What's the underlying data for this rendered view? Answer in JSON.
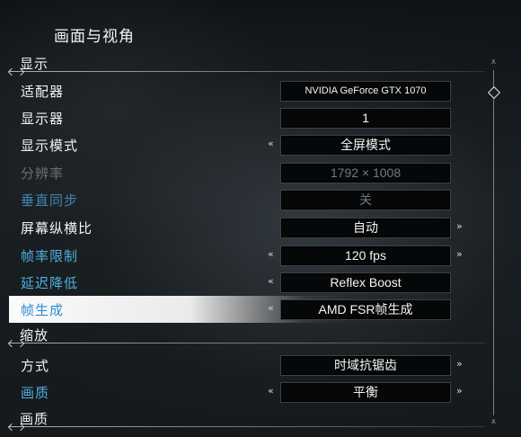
{
  "page_title": "画面与视角",
  "sections": {
    "display": "显示",
    "scaling": "缩放",
    "quality": "画质"
  },
  "rows": {
    "adapter": {
      "label": "适配器",
      "value": "NVIDIA GeForce GTX 1070"
    },
    "monitor": {
      "label": "显示器",
      "value": "1"
    },
    "display_mode": {
      "label": "显示模式",
      "value": "全屏模式",
      "left_arrow": "«",
      "right_arrow": "»"
    },
    "resolution": {
      "label": "分辨率",
      "value": "1792 × 1008"
    },
    "vsync": {
      "label": "垂直同步",
      "value": "关"
    },
    "aspect_ratio": {
      "label": "屏幕纵横比",
      "value": "自动",
      "right_arrow": "»"
    },
    "frame_limit": {
      "label": "帧率限制",
      "value": "120 fps",
      "left_arrow": "«",
      "right_arrow": "»"
    },
    "latency": {
      "label": "延迟降低",
      "value": "Reflex Boost",
      "left_arrow": "«"
    },
    "frame_gen": {
      "label": "帧生成",
      "value": "AMD FSR帧生成",
      "left_arrow": "«"
    },
    "method": {
      "label": "方式",
      "value": "时域抗锯齿",
      "right_arrow": "»"
    },
    "quality": {
      "label": "画质",
      "value": "平衡",
      "left_arrow": "«",
      "right_arrow": "»"
    }
  },
  "scrollbar": {
    "top_icon": "double-chevron-down-icon",
    "bottom_icon": "double-chevron-down-icon",
    "thumb_icon": "diamond-icon",
    "top_glyph": "⩡",
    "bottom_glyph": "⩡",
    "position": 0.06
  },
  "colors": {
    "label_default": "#f2f2f2",
    "label_blue": "#4fb0dd",
    "label_disabled": "#6b6f72",
    "selected_label": "#2c8fd1",
    "value_box_bg": "#060708"
  }
}
